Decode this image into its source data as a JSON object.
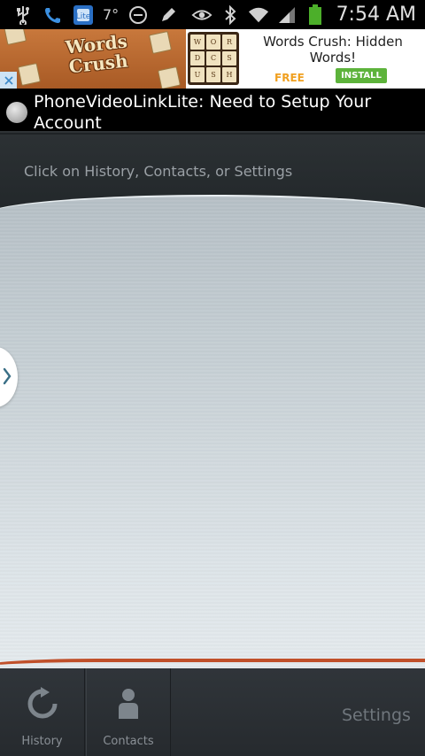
{
  "status_bar": {
    "temperature": "7°",
    "time": "7:54 AM"
  },
  "ad": {
    "logo_text_line1": "Words",
    "logo_text_line2": "Crush",
    "tiles": [
      "W",
      "O",
      "R",
      "D",
      "C",
      "S",
      "U",
      "S",
      "H"
    ],
    "title": "Words Crush: Hidden Words!",
    "free_label": "FREE",
    "install_label": "INSTALL"
  },
  "notification": {
    "text": "PhoneVideoLinkLite: Need to Setup Your Account"
  },
  "header": {
    "hint": "Click on History, Contacts, or Settings"
  },
  "nav": {
    "history_label": "History",
    "contacts_label": "Contacts",
    "settings_label": "Settings"
  },
  "colors": {
    "accent_orange": "#c0502a",
    "ad_install_green": "#5db33b",
    "ad_free_orange": "#f0a020"
  }
}
